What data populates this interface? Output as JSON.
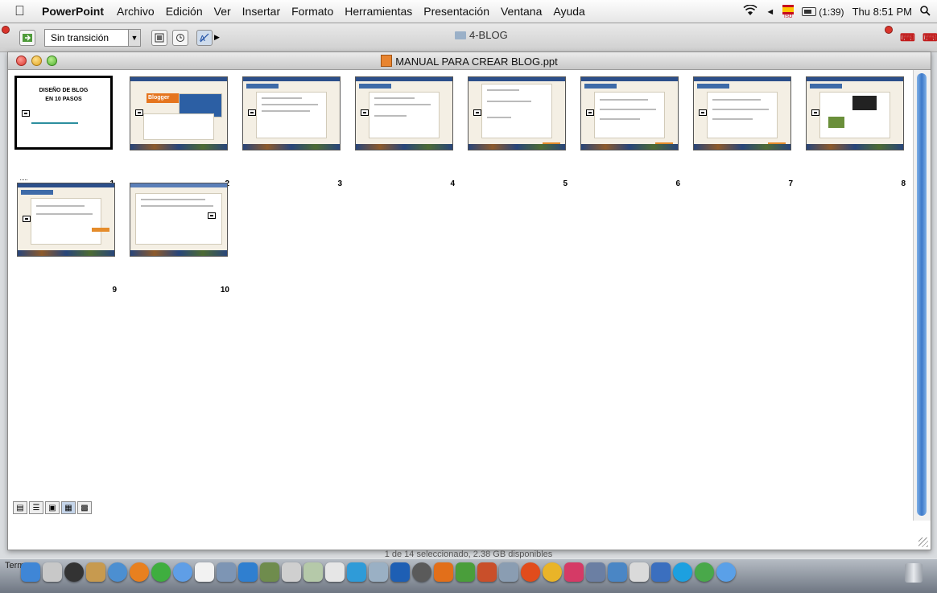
{
  "menubar": {
    "app": "PowerPoint",
    "items": [
      "Archivo",
      "Edición",
      "Ver",
      "Insertar",
      "Formato",
      "Herramientas",
      "Presentación",
      "Ventana",
      "Ayuda"
    ],
    "battery_time": "(1:39)",
    "clock": "Thu 8:51 PM",
    "flag_label": "ISO"
  },
  "toolbar": {
    "transition": "Sin transición",
    "folder": "4-BLOG"
  },
  "window": {
    "title": "MANUAL PARA CREAR BLOG.ppt"
  },
  "slides": [
    {
      "number": "1",
      "title_line1": "DISEÑO DE BLOG",
      "title_line2": "EN 10 PASOS"
    },
    {
      "number": "2",
      "logo": "Blogger"
    },
    {
      "number": "3"
    },
    {
      "number": "4"
    },
    {
      "number": "5"
    },
    {
      "number": "6"
    },
    {
      "number": "7"
    },
    {
      "number": "8"
    },
    {
      "number": "9"
    },
    {
      "number": "10"
    }
  ],
  "finder_status": "1 de 14 seleccionado, 2.38 GB disponibles",
  "dock": {
    "label": "Term"
  },
  "colors": {
    "accent": "#3b78c9",
    "blogger_orange": "#e5751f",
    "slide_bg": "#f4efe4"
  }
}
